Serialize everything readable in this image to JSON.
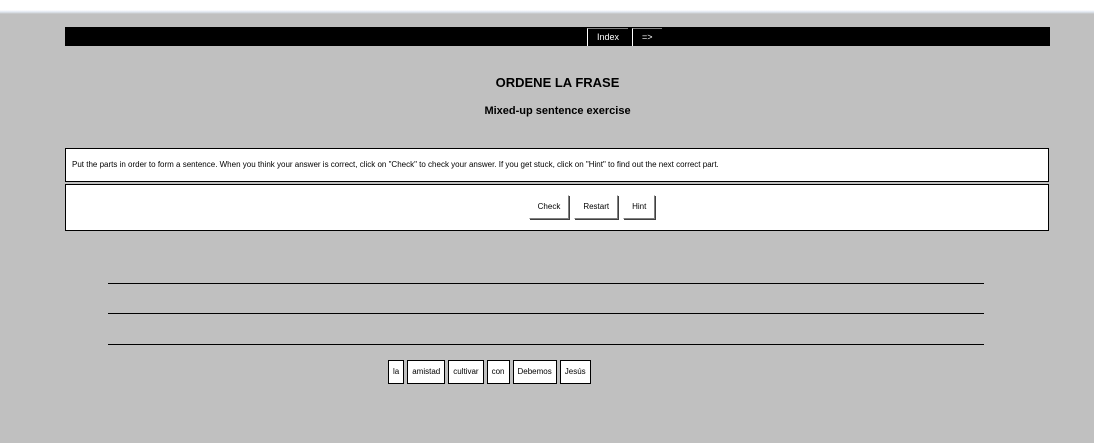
{
  "nav": {
    "items": [
      {
        "label": "Index"
      },
      {
        "label": "=>"
      }
    ]
  },
  "header": {
    "title": "ORDENE LA FRASE",
    "subtitle": "Mixed-up sentence exercise"
  },
  "instructions": {
    "text": "Put the parts in order to form a sentence. When you think your answer is correct, click on \"Check\" to check your answer. If you get stuck, click on \"Hint\" to find out the next correct part."
  },
  "controls": {
    "check_label": "Check",
    "restart_label": "Restart",
    "hint_label": "Hint"
  },
  "answer_lines_count": 3,
  "tiles": [
    "la",
    "amistad",
    "cultivar",
    "con",
    "Debemos",
    "Jesús"
  ],
  "colors": {
    "background": "#c0c0c0",
    "navbar": "#000000",
    "panel": "#ffffff"
  }
}
